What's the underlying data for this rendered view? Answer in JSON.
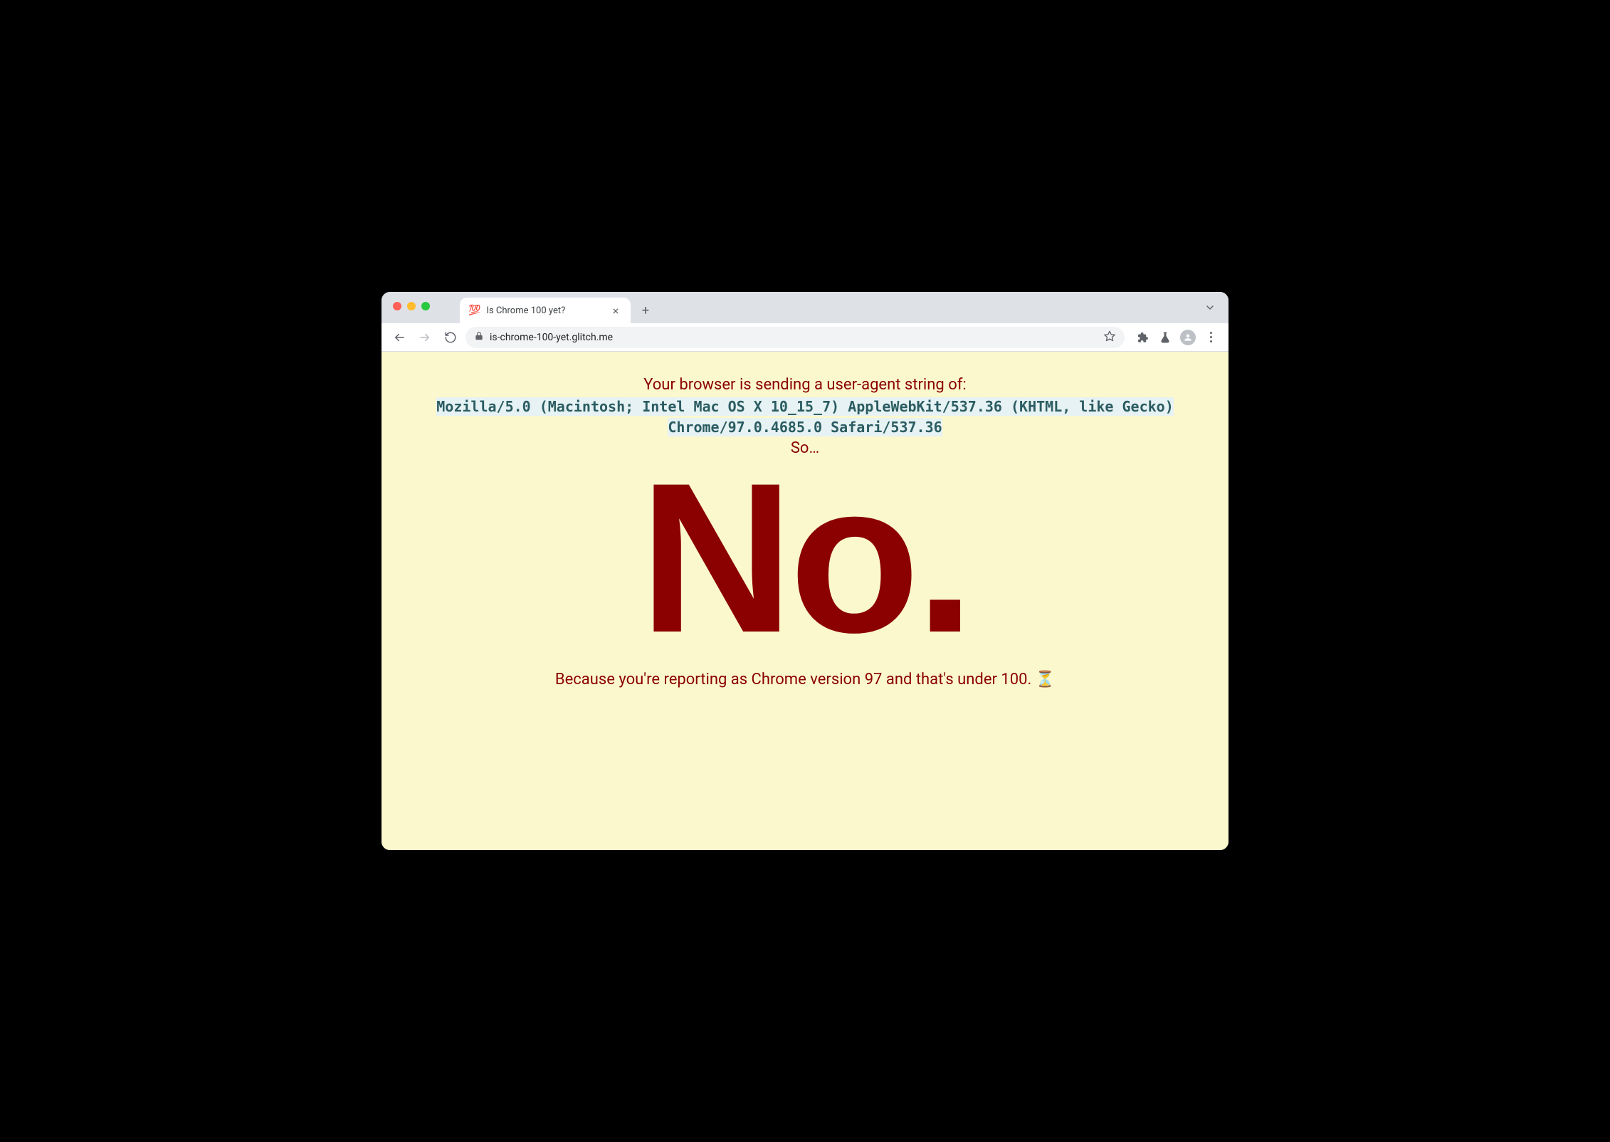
{
  "tab": {
    "favicon": "💯",
    "title": "Is Chrome 100 yet?"
  },
  "toolbar": {
    "url": "is-chrome-100-yet.glitch.me"
  },
  "page": {
    "intro": "Your browser is sending a user-agent string of:",
    "user_agent": "Mozilla/5.0 (Macintosh; Intel Mac OS X 10_15_7) AppleWebKit/537.36 (KHTML, like Gecko) Chrome/97.0.4685.0 Safari/537.36",
    "so": "So…",
    "verdict": "No.",
    "reason": "Because you're reporting as Chrome version 97 and that's under 100. ⏳"
  }
}
